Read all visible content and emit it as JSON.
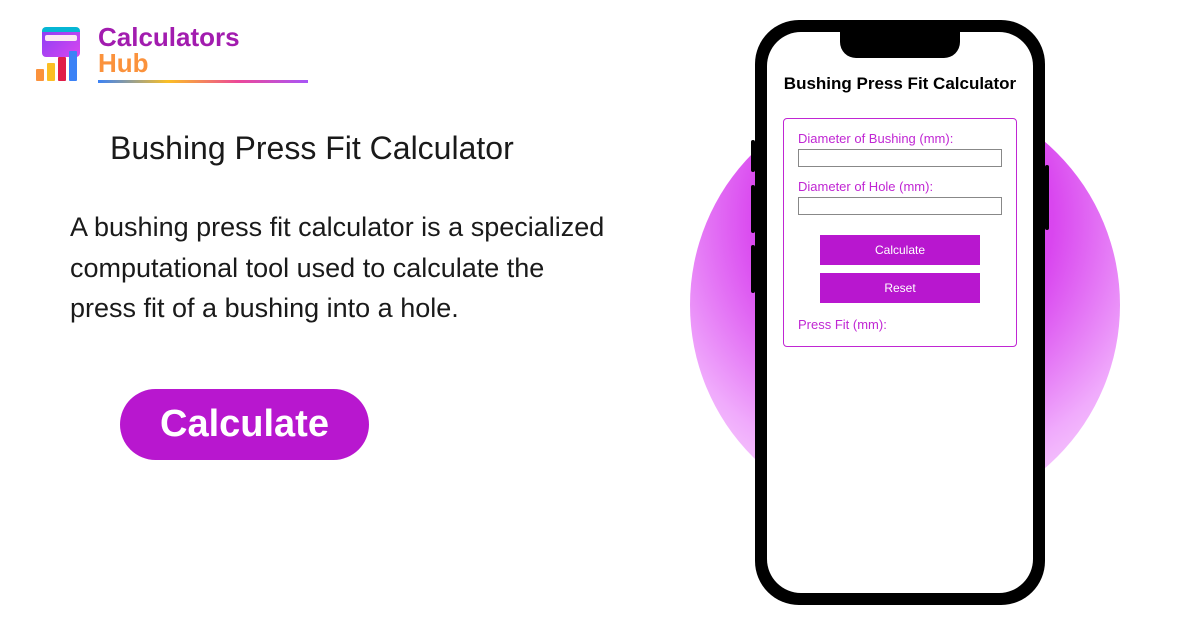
{
  "logo": {
    "text_top": "Calculators",
    "text_bottom": "Hub"
  },
  "main": {
    "page_title": "Bushing Press Fit Calculator",
    "description": "A bushing press fit calculator is a specialized computational tool used to calculate the press fit of a bushing into a hole.",
    "cta_label": "Calculate"
  },
  "phone": {
    "calc_title": "Bushing Press Fit Calculator",
    "form": {
      "bushing_label": "Diameter of Bushing (mm):",
      "bushing_value": "",
      "hole_label": "Diameter of Hole (mm):",
      "hole_value": "",
      "calculate_label": "Calculate",
      "reset_label": "Reset",
      "result_label": "Press Fit (mm):"
    }
  }
}
